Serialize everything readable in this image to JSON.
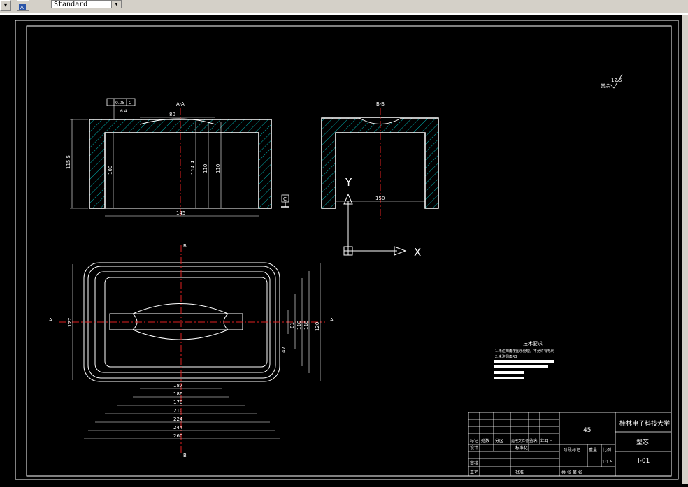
{
  "toolbar": {
    "textstyle_value": "Standard",
    "icons": [
      "dropdown-arrow-icon",
      "text-style-icon"
    ]
  },
  "drawing": {
    "view_a_title": "A-A",
    "view_b_title": "B-B",
    "ucs": {
      "y_label": "Y",
      "x_label": "X"
    },
    "datum": "C",
    "section_a_label": "A",
    "section_b_label": "B",
    "tolerance_frame": [
      "0.05",
      "C"
    ],
    "roughness_top": "6.4",
    "roughness_corner": {
      "prefix": "其余",
      "value": "12.5"
    },
    "dims_aa": {
      "overall_height": "115.5",
      "inner_height": "100",
      "depth_1": "114.4",
      "depth_2": "110",
      "depth_3": "110",
      "top_width": "80",
      "bottom_width": "145"
    },
    "dims_bb": {
      "width": "150"
    },
    "dims_plan": {
      "left_height": "127",
      "right_heights": [
        "81",
        "110",
        "118",
        "120"
      ],
      "small": "47",
      "bottom_widths": [
        "187",
        "186",
        "170",
        "210",
        "224",
        "244",
        "260"
      ]
    },
    "tech_requirements": {
      "title": "技术要求",
      "lines": [
        "1.未注倒角按图示处理，不允许有毛刺",
        "2.未注圆角R3"
      ]
    },
    "title_block": {
      "material": "45",
      "school": "桂林电子科技大学",
      "part_name": "型芯",
      "drawing_no": "I-01",
      "scale": "1:1.5",
      "cells": [
        "标记",
        "处数",
        "分区",
        "更改文件号",
        "签名",
        "年月日",
        "设计",
        "标准化",
        "阶段标记",
        "重量",
        "比例",
        "审核",
        "工艺",
        "批准",
        "共 张 第 张"
      ]
    }
  }
}
